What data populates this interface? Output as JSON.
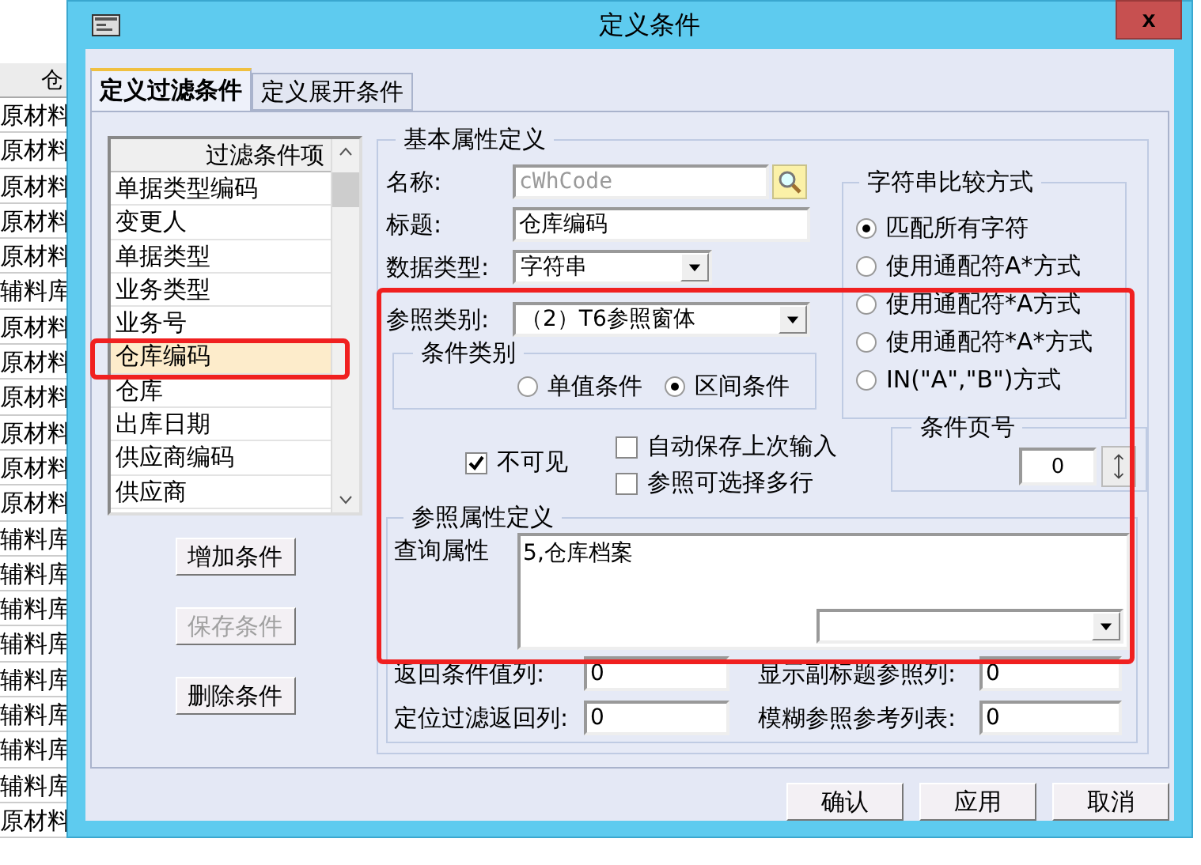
{
  "background": {
    "header": "仓",
    "column_rows": [
      "原材料",
      "原材料",
      "原材料",
      "原材料",
      "原材料",
      "辅料库",
      "原材料",
      "原材料",
      "原材料",
      "原材料",
      "原材料",
      "原材料",
      "辅料库",
      "辅料库",
      "辅料库",
      "辅料库",
      "辅料库",
      "辅料库",
      "辅料库",
      "辅料库",
      "原材料"
    ]
  },
  "window": {
    "title": "定义条件",
    "close": "x"
  },
  "tabs": [
    {
      "label": "定义过滤条件",
      "selected": true
    },
    {
      "label": "定义展开条件",
      "selected": false
    }
  ],
  "filter_list": {
    "header": "过滤条件项",
    "items": [
      {
        "label": "单据类型编码",
        "selected": false
      },
      {
        "label": "变更人",
        "selected": false
      },
      {
        "label": "单据类型",
        "selected": false
      },
      {
        "label": "业务类型",
        "selected": false
      },
      {
        "label": "业务号",
        "selected": false
      },
      {
        "label": "仓库编码",
        "selected": true
      },
      {
        "label": "仓库",
        "selected": false
      },
      {
        "label": "出库日期",
        "selected": false
      },
      {
        "label": "供应商编码",
        "selected": false
      },
      {
        "label": "供应商",
        "selected": false
      }
    ]
  },
  "list_buttons": [
    {
      "label": "增加条件",
      "disabled": false
    },
    {
      "label": "保存条件",
      "disabled": true
    },
    {
      "label": "删除条件",
      "disabled": false
    }
  ],
  "basic": {
    "title": "基本属性定义",
    "name": {
      "label": "名称:",
      "value": "cWhCode",
      "disabled": true
    },
    "caption": {
      "label": "标题:",
      "value": "仓库编码"
    },
    "data_type": {
      "label": "数据类型:",
      "value": "字符串"
    },
    "ref_type": {
      "label": "参照类别:",
      "value": "（2）T6参照窗体"
    },
    "condition_type": {
      "title": "条件类别",
      "options": [
        {
          "label": "单值条件",
          "selected": false
        },
        {
          "label": "区间条件",
          "selected": true
        }
      ]
    },
    "compare": {
      "title": "字符串比较方式",
      "options": [
        {
          "label": "匹配所有字符",
          "selected": true
        },
        {
          "label": "使用通配符A*方式",
          "selected": false
        },
        {
          "label": "使用通配符*A方式",
          "selected": false
        },
        {
          "label": "使用通配符*A*方式",
          "selected": false
        },
        {
          "label": "IN(\"A\",\"B\")方式",
          "selected": false
        }
      ]
    },
    "invisible": {
      "label": "不可见",
      "checked": true
    },
    "options": [
      {
        "label": "自动保存上次输入",
        "checked": false
      },
      {
        "label": "参照可选择多行",
        "checked": false
      }
    ],
    "page": {
      "title": "条件页号",
      "value": "0"
    }
  },
  "reference": {
    "title": "参照属性定义",
    "query_label": "查询属性",
    "query_value": "5,仓库档案",
    "fields": [
      {
        "label": "返回条件值列:",
        "value": "0"
      },
      {
        "label": "显示副标题参照列:",
        "value": "0"
      },
      {
        "label": "定位过滤返回列:",
        "value": "0"
      },
      {
        "label": "模糊参照参考列表:",
        "value": "0"
      }
    ]
  },
  "buttons": [
    "确认",
    "应用",
    "取消"
  ]
}
